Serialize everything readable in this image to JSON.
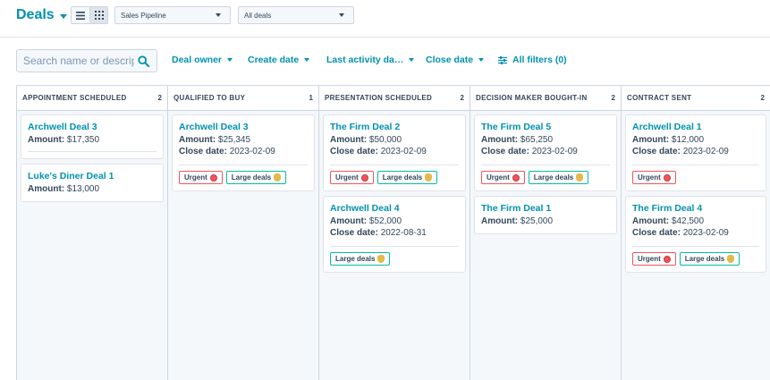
{
  "header": {
    "title": "Deals",
    "pipeline_select": "Sales Pipeline",
    "deals_select": "All deals"
  },
  "filters": {
    "search_placeholder": "Search name or description",
    "deal_owner": "Deal owner",
    "create_date": "Create date",
    "last_activity_date": "Last activity da…",
    "close_date": "Close date",
    "all_filters": "All filters (0)"
  },
  "labels": {
    "amount": "Amount:",
    "close_date": "Close date:",
    "urgent": "Urgent",
    "large_deals": "Large deals"
  },
  "columns": [
    {
      "name": "APPOINTMENT SCHEDULED",
      "count": "2",
      "deals": [
        {
          "name": "Archwell Deal 3",
          "amount": "$17,350"
        },
        {
          "name": "Luke's Diner Deal 1",
          "amount": "$13,000"
        }
      ]
    },
    {
      "name": "QUALIFIED TO BUY",
      "count": "1",
      "deals": [
        {
          "name": "Archwell Deal 3",
          "amount": "$25,345",
          "close_date": "2023-02-09"
        }
      ]
    },
    {
      "name": "PRESENTATION SCHEDULED",
      "count": "2",
      "deals": [
        {
          "name": "The Firm Deal 2",
          "amount": "$50,000",
          "close_date": "2023-02-09"
        },
        {
          "name": "Archwell Deal 4",
          "amount": "$52,000",
          "close_date": "2022-08-31"
        }
      ]
    },
    {
      "name": "DECISION MAKER BOUGHT-IN",
      "count": "2",
      "deals": [
        {
          "name": "The Firm Deal 5",
          "amount": "$65,250",
          "close_date": "2023-02-09"
        },
        {
          "name": "The Firm Deal 1",
          "amount": "$25,000"
        }
      ]
    },
    {
      "name": "CONTRACT SENT",
      "count": "2",
      "deals": [
        {
          "name": "Archwell Deal 1",
          "amount": "$12,000",
          "close_date": "2023-02-09"
        },
        {
          "name": "The Firm Deal 4",
          "amount": "$42,500",
          "close_date": "2023-02-09"
        }
      ]
    }
  ],
  "colors": {
    "accent": "#0091ae",
    "text": "#33475b",
    "urgent": "#f2545b",
    "large": "#00bda5"
  }
}
